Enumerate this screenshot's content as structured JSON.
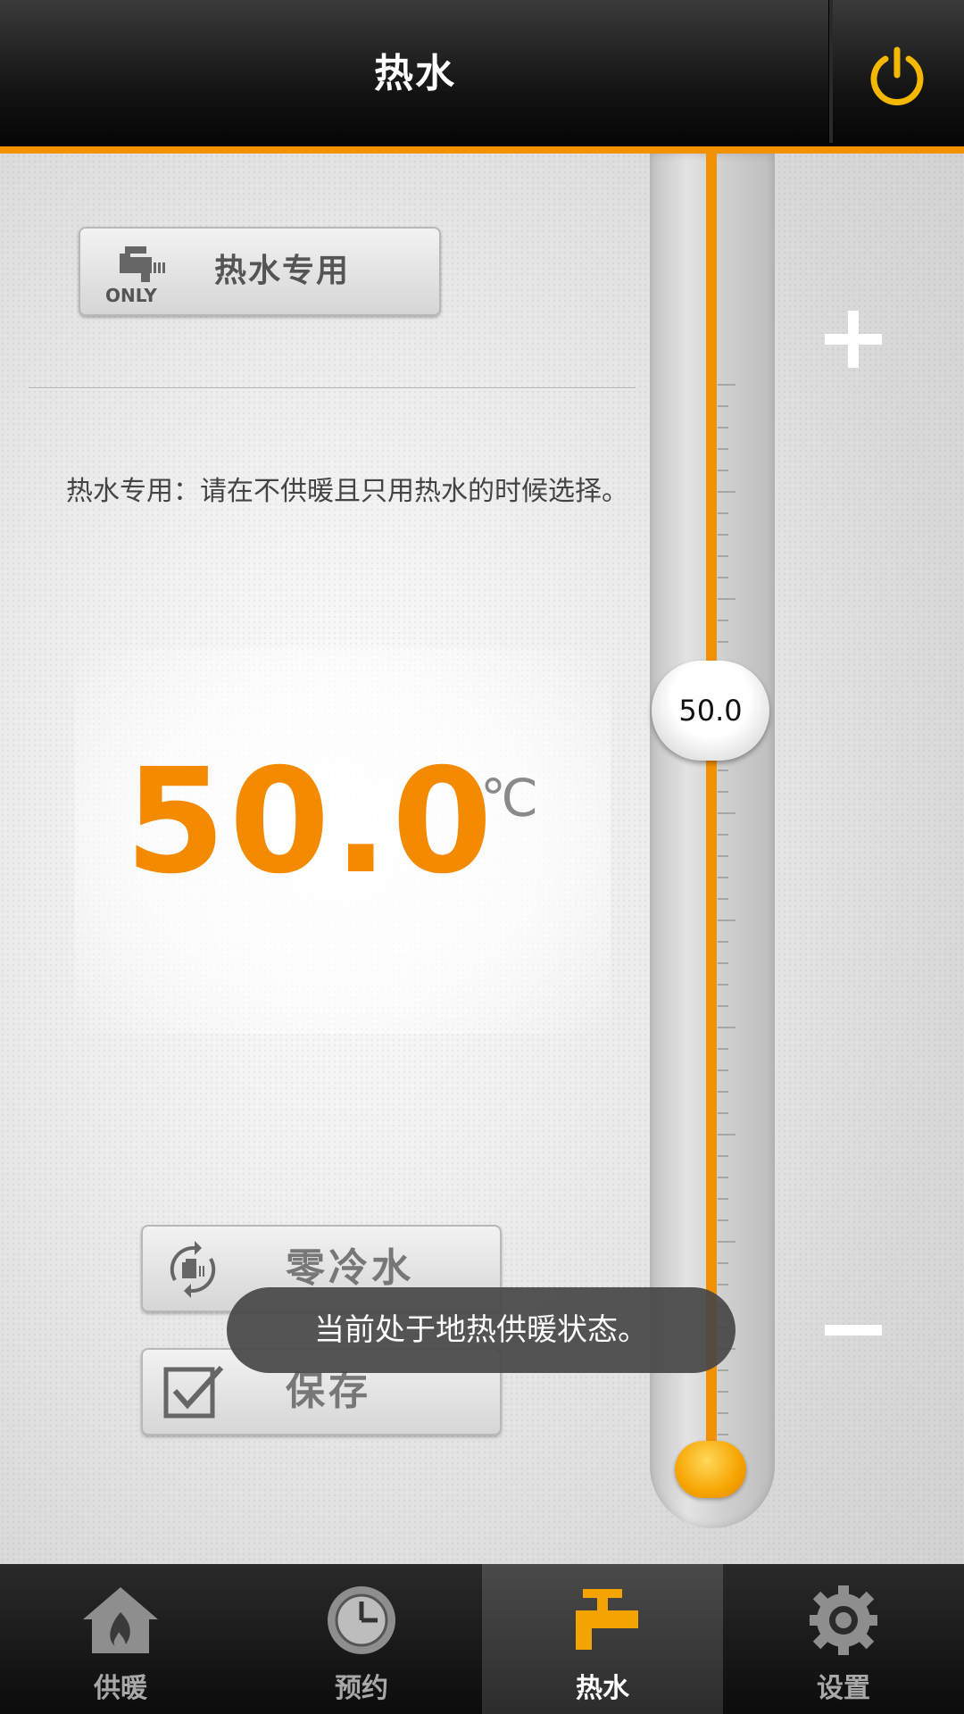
{
  "header": {
    "title": "热水",
    "power_icon": "power-icon",
    "accent": "#f39200"
  },
  "mode_button": {
    "icon": "faucet-only-icon",
    "icon_text": "ONLY",
    "label": "热水专用"
  },
  "description": "热水专用：请在不供暖且只用热水的时候选择。",
  "temperature": {
    "value": "50.0",
    "unit": "℃",
    "color": "#f38a00"
  },
  "slider": {
    "knob_value": "50.0",
    "plus_icon": "plus-icon",
    "minus_icon": "minus-icon"
  },
  "buttons": {
    "zero_cold_water": "零冷水",
    "save": "保存"
  },
  "toast": "当前处于地热供暖状态。",
  "nav": {
    "items": [
      {
        "label": "供暖",
        "icon": "house-flame-icon",
        "active": false
      },
      {
        "label": "预约",
        "icon": "clock-icon",
        "active": false
      },
      {
        "label": "热水",
        "icon": "faucet-icon",
        "active": true
      },
      {
        "label": "设置",
        "icon": "gear-icon",
        "active": false
      }
    ]
  }
}
